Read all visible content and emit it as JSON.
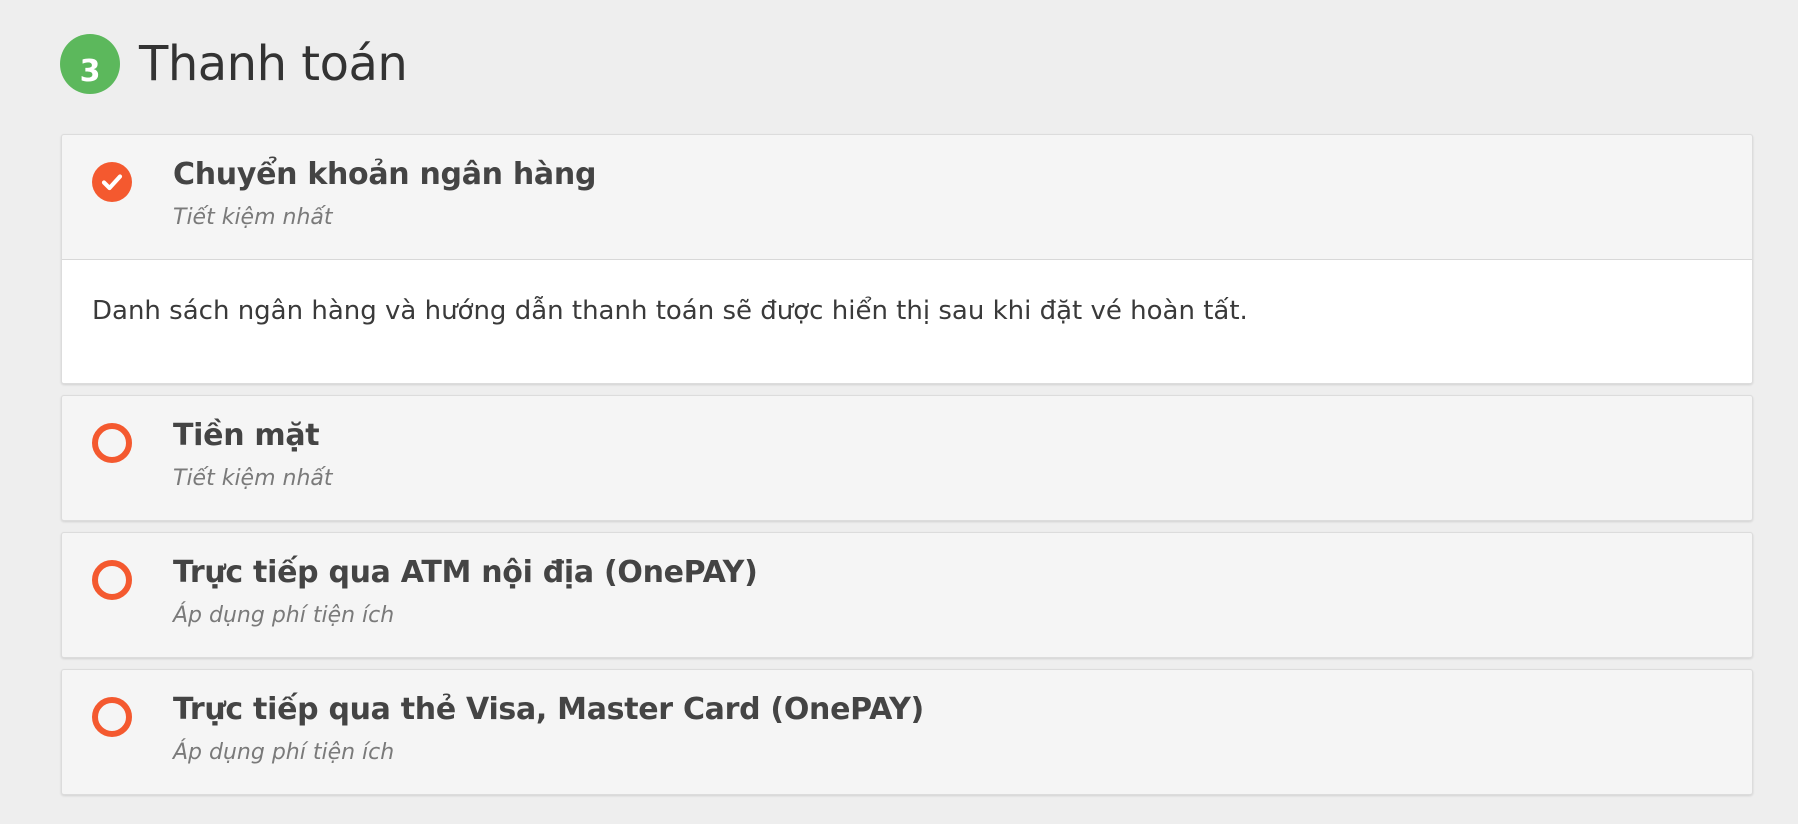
{
  "section": {
    "step_number": "3",
    "title": "Thanh toán"
  },
  "payment_options": [
    {
      "title": "Chuyển khoản ngân hàng",
      "subtitle": "Tiết kiệm nhất",
      "selected": true,
      "details": "Danh sách ngân hàng và hướng dẫn thanh toán sẽ được hiển thị sau khi đặt vé hoàn tất."
    },
    {
      "title": "Tiền mặt",
      "subtitle": "Tiết kiệm nhất",
      "selected": false
    },
    {
      "title": "Trực tiếp qua ATM nội địa (OnePAY)",
      "subtitle": "Áp dụng phí tiện ích",
      "selected": false
    },
    {
      "title": "Trực tiếp qua thẻ Visa, Master Card (OnePAY)",
      "subtitle": "Áp dụng phí tiện ích",
      "selected": false
    }
  ],
  "colors": {
    "accent": "#f4592f",
    "step_badge": "#5cb85c",
    "background": "#eeeeee"
  },
  "icons": {
    "selected": "check-circle-icon",
    "unselected": "radio-circle-icon"
  }
}
